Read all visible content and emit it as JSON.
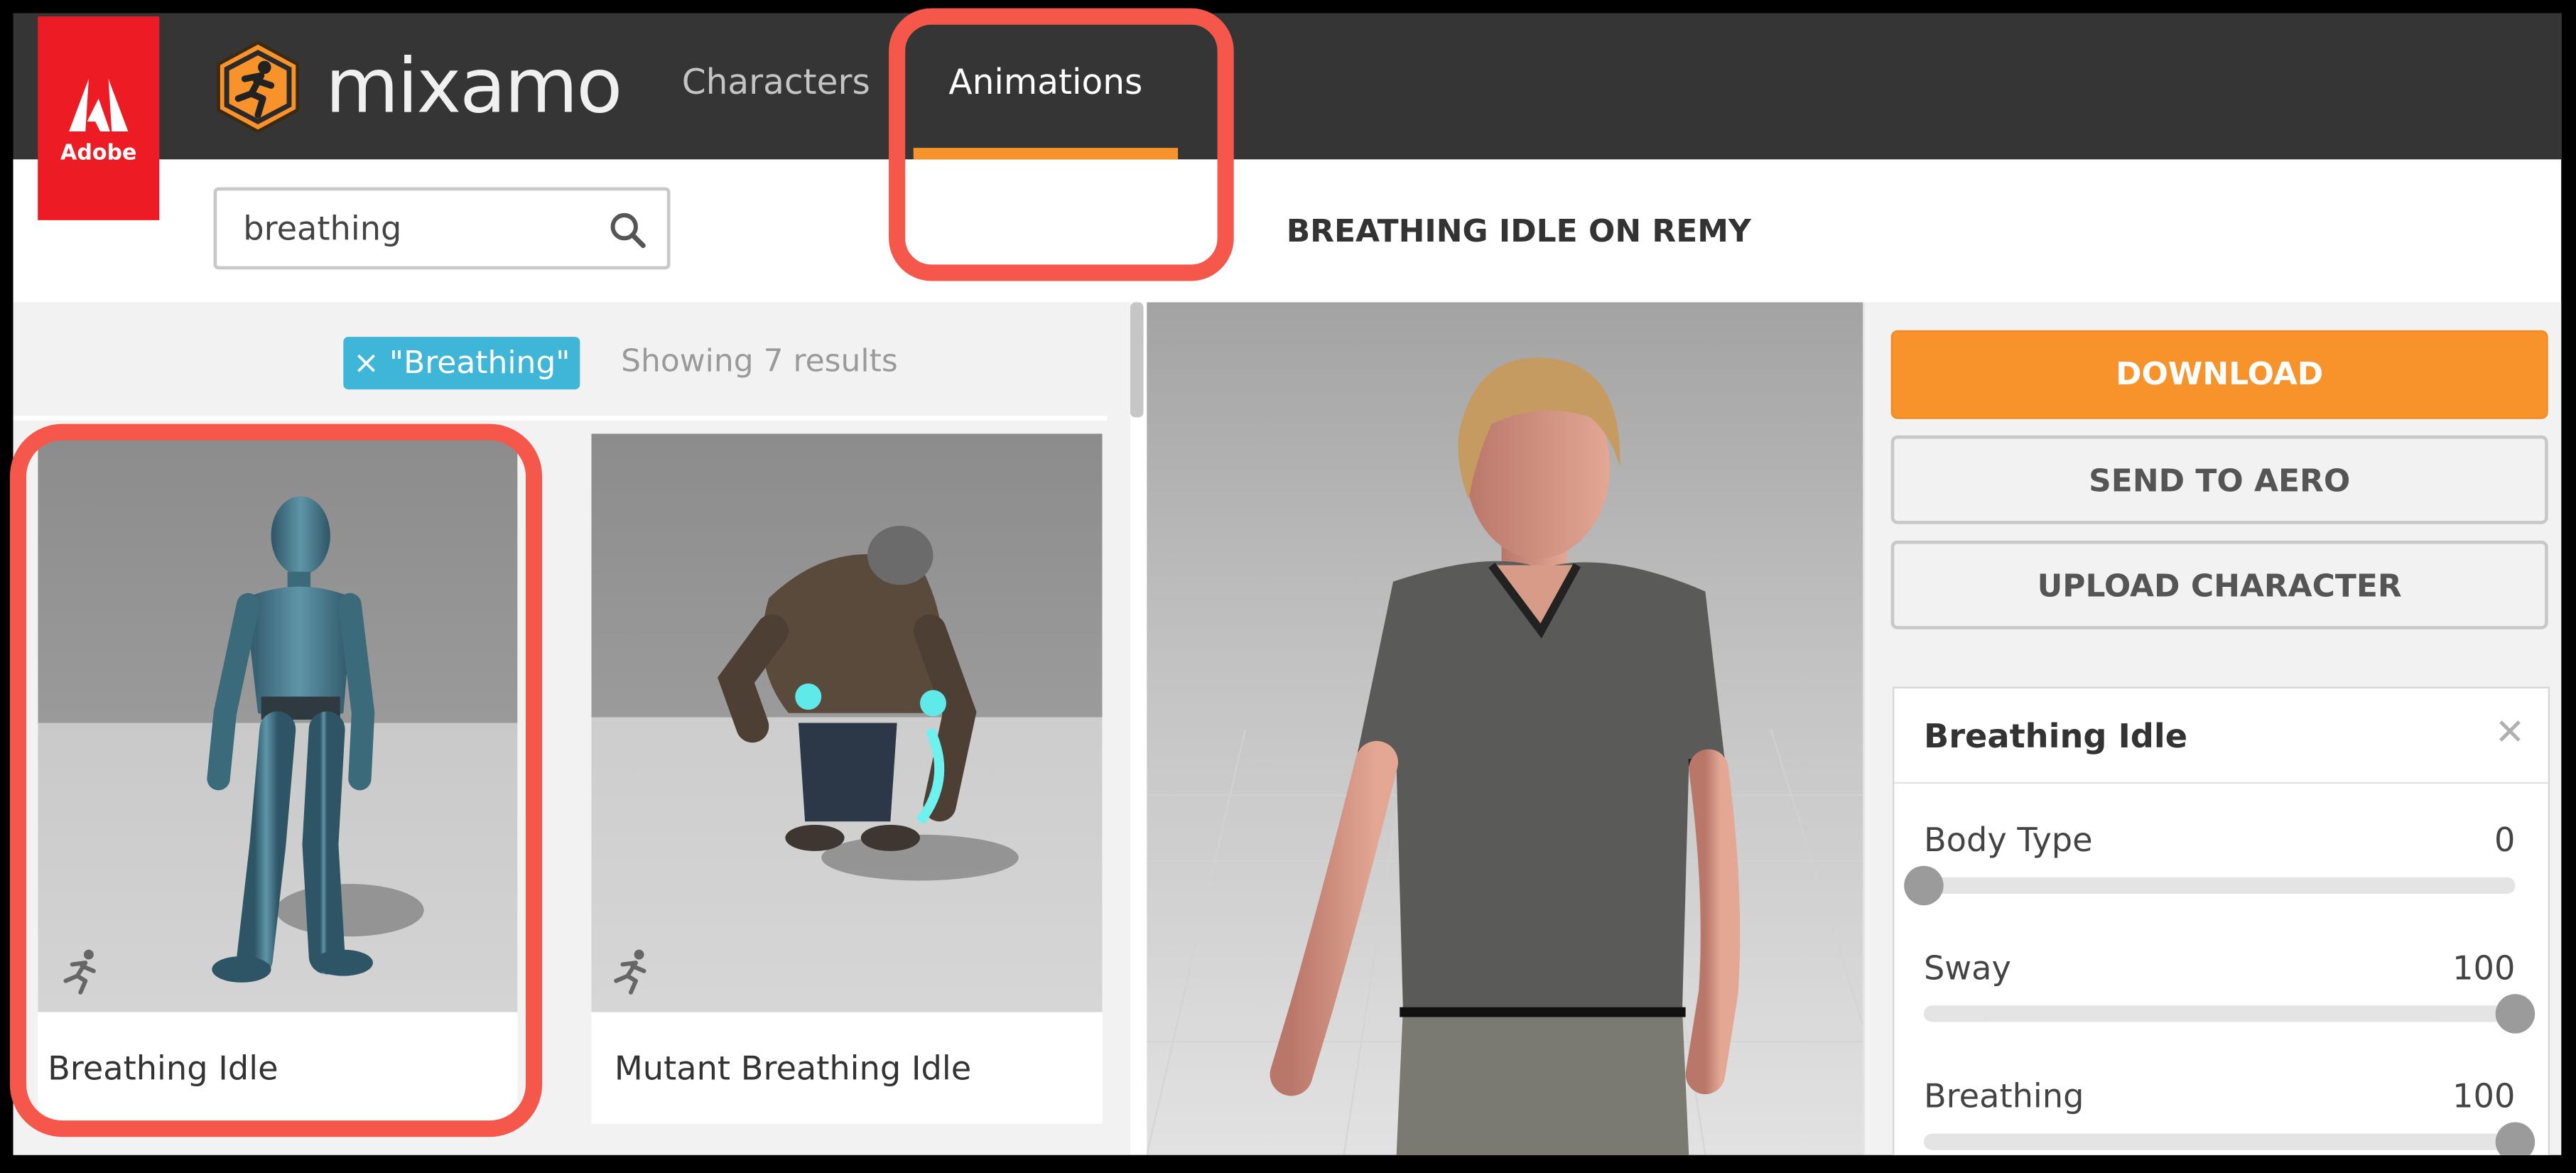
{
  "brand": {
    "adobe_label": "Adobe",
    "app_name": "mixamo"
  },
  "nav": {
    "characters": "Characters",
    "animations": "Animations",
    "active_color": "#f7932a"
  },
  "search": {
    "value": "breathing"
  },
  "filter": {
    "chip": "× \"Breathing\"",
    "count": "Showing 7 results"
  },
  "results": [
    {
      "name": "Breathing Idle"
    },
    {
      "name": "Mutant Breathing Idle"
    }
  ],
  "detail": {
    "title": "BREATHING IDLE ON REMY"
  },
  "actions": {
    "download": "DOWNLOAD",
    "send_to_aero": "SEND TO AERO",
    "upload": "UPLOAD CHARACTER"
  },
  "settings": {
    "title": "Breathing Idle",
    "sliders": [
      {
        "label": "Body Type",
        "value": "0",
        "fraction": 0
      },
      {
        "label": "Sway",
        "value": "100",
        "fraction": 1
      },
      {
        "label": "Breathing",
        "value": "100",
        "fraction": 1
      }
    ]
  },
  "colors": {
    "adobe_red": "#ed1c24",
    "accent_orange": "#f7932a",
    "chip_blue": "#3fb5d8",
    "highlight": "#f5574b"
  }
}
